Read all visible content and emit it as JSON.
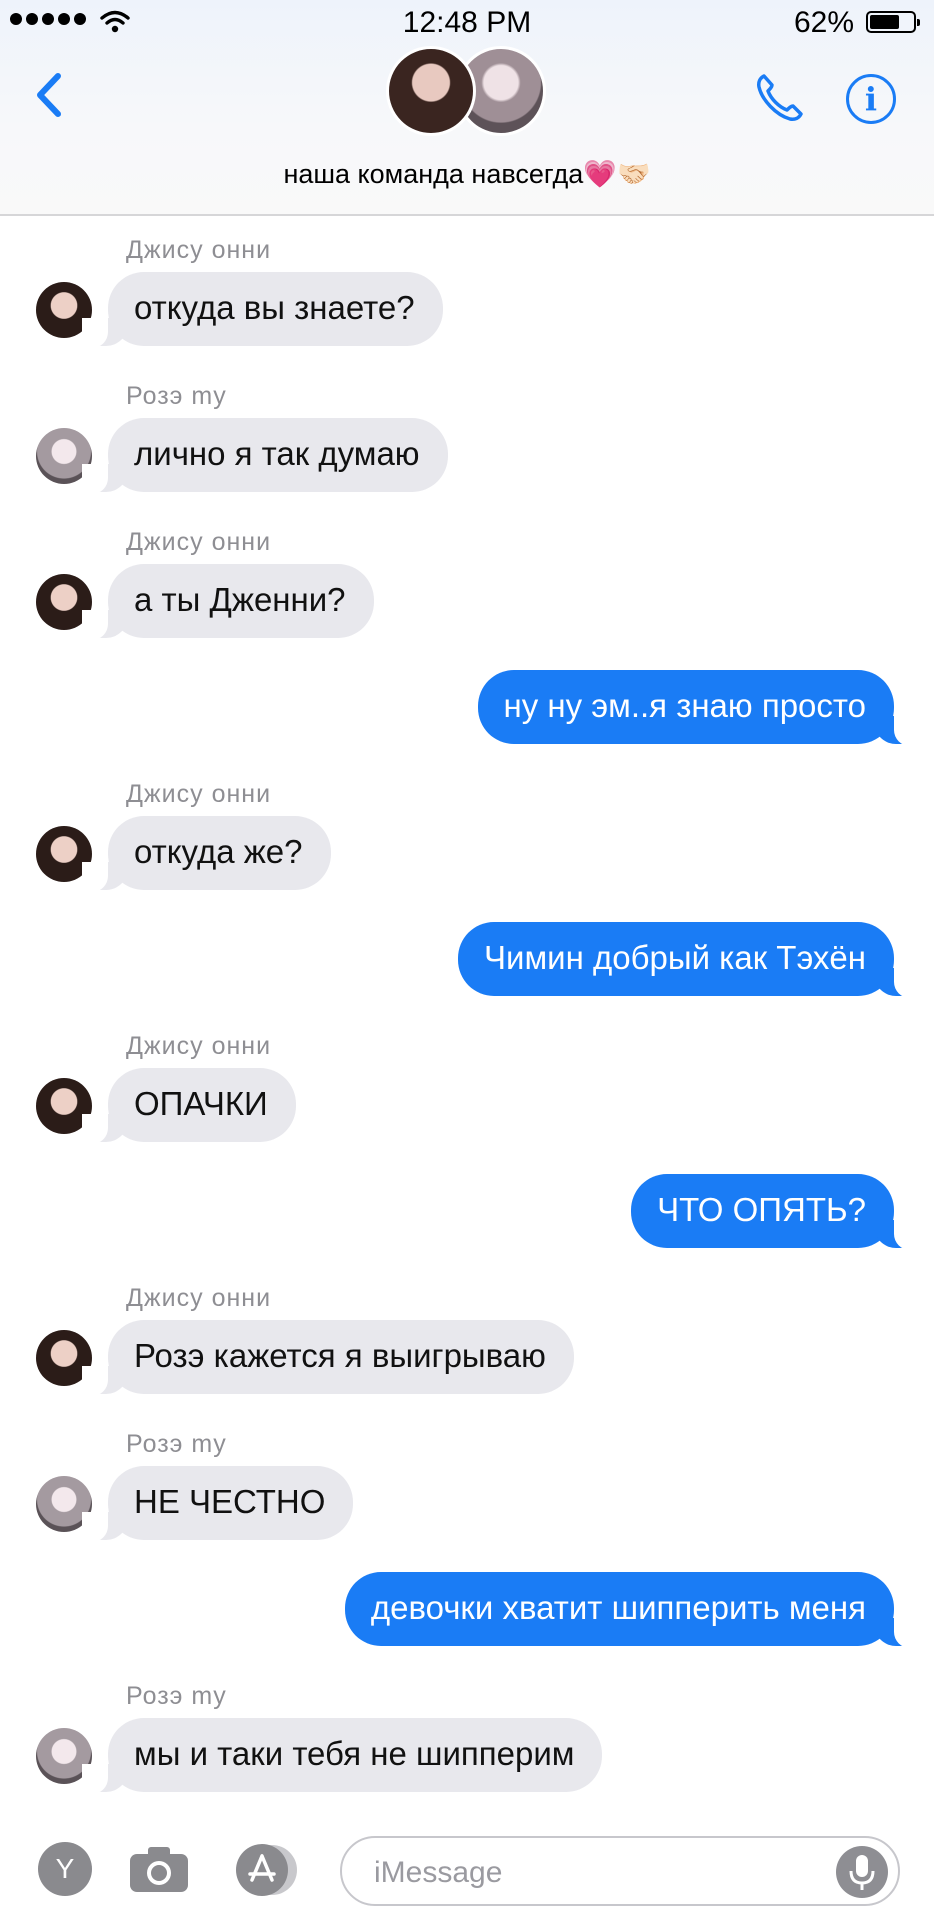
{
  "status_bar": {
    "time": "12:48 PM",
    "battery": "62%",
    "battery_fraction": 0.62
  },
  "header": {
    "group_name": "наша команда навсегда💗🤝🏻",
    "avatars": [
      "avatar-jisoo",
      "avatar-rose"
    ]
  },
  "messages": [
    {
      "sender": "Джису онни",
      "avatar": "jisoo",
      "dir": "in",
      "text": "откуда вы знаете?"
    },
    {
      "sender": "Розэ my",
      "avatar": "rose",
      "dir": "in",
      "text": "лично я так думаю"
    },
    {
      "sender": "Джису онни",
      "avatar": "jisoo",
      "dir": "in",
      "text": "а ты Дженни?"
    },
    {
      "sender": "",
      "avatar": "",
      "dir": "out",
      "text": "ну ну эм..я знаю просто"
    },
    {
      "sender": "Джису онни",
      "avatar": "jisoo",
      "dir": "in",
      "text": "откуда же?"
    },
    {
      "sender": "",
      "avatar": "",
      "dir": "out",
      "text": "Чимин добрый как Тэхён"
    },
    {
      "sender": "Джису онни",
      "avatar": "jisoo",
      "dir": "in",
      "text": "ОПАЧКИ"
    },
    {
      "sender": "",
      "avatar": "",
      "dir": "out",
      "text": "ЧТО ОПЯТЬ?"
    },
    {
      "sender": "Джису онни",
      "avatar": "jisoo",
      "dir": "in",
      "text": "Розэ кажется я выигрываю"
    },
    {
      "sender": "Розэ my",
      "avatar": "rose",
      "dir": "in",
      "text": "НЕ ЧЕСТНО"
    },
    {
      "sender": "",
      "avatar": "",
      "dir": "out",
      "text": "девочки хватит шипперить меня"
    },
    {
      "sender": "Розэ my",
      "avatar": "rose",
      "dir": "in",
      "text": "мы и таки тебя не шипперим"
    }
  ],
  "input_bar": {
    "app_button": "Y",
    "placeholder": "iMessage",
    "icons": [
      "camera-icon",
      "appstore-icon",
      "microphone-icon"
    ]
  },
  "colors": {
    "accent": "#1a7cf5",
    "incoming_bubble": "#e8e8ed",
    "sender_gray": "#8e8e93"
  }
}
